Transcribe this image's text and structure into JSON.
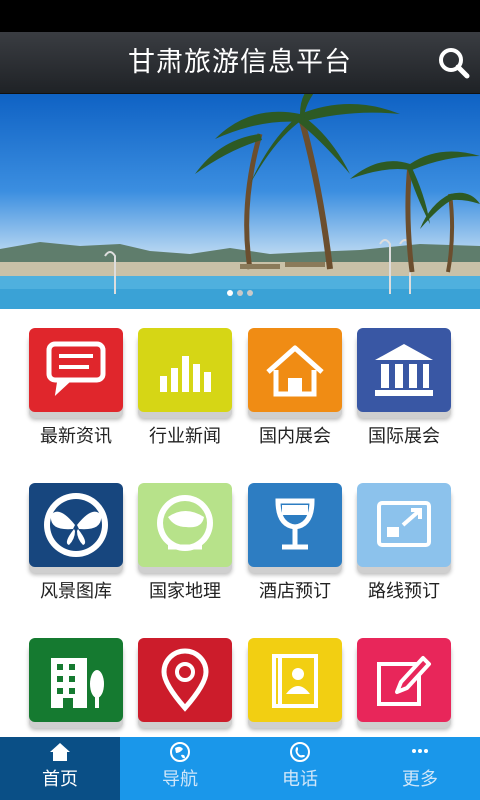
{
  "header": {
    "title": "甘肃旅游信息平台",
    "search_icon": "search-icon"
  },
  "banner": {
    "slides": 3,
    "current": 1
  },
  "grid": [
    {
      "label": "最新资讯",
      "color": "#e0262c",
      "icon": "message-icon"
    },
    {
      "label": "行业新闻",
      "color": "#d6d615",
      "icon": "bar-chart-icon"
    },
    {
      "label": "国内展会",
      "color": "#f08c14",
      "icon": "house-icon"
    },
    {
      "label": "国际展会",
      "color": "#3957a4",
      "icon": "bank-building-icon"
    },
    {
      "label": "风景图库",
      "color": "#17467e",
      "icon": "butterfly-icon"
    },
    {
      "label": "国家地理",
      "color": "#b7e28a",
      "icon": "globe-icon"
    },
    {
      "label": "酒店预订",
      "color": "#2d7dc2",
      "icon": "wine-glass-icon"
    },
    {
      "label": "路线预订",
      "color": "#8cc2ec",
      "icon": "expand-icon"
    },
    {
      "label": "",
      "color": "#157a30",
      "icon": "office-building-icon"
    },
    {
      "label": "",
      "color": "#cc1c2b",
      "icon": "location-pin-icon"
    },
    {
      "label": "",
      "color": "#f2cf12",
      "icon": "contact-book-icon"
    },
    {
      "label": "",
      "color": "#e8265a",
      "icon": "edit-icon"
    }
  ],
  "tabs": [
    {
      "label": "首页",
      "icon": "home-icon",
      "active": true
    },
    {
      "label": "导航",
      "icon": "globe-icon",
      "active": false
    },
    {
      "label": "电话",
      "icon": "phone-icon",
      "active": false
    },
    {
      "label": "更多",
      "icon": "more-icon",
      "active": false
    }
  ],
  "colors": {
    "tabbar": "#1a97ea",
    "tab_active": "#0a4f86",
    "titlebar": "#2b2e33"
  }
}
